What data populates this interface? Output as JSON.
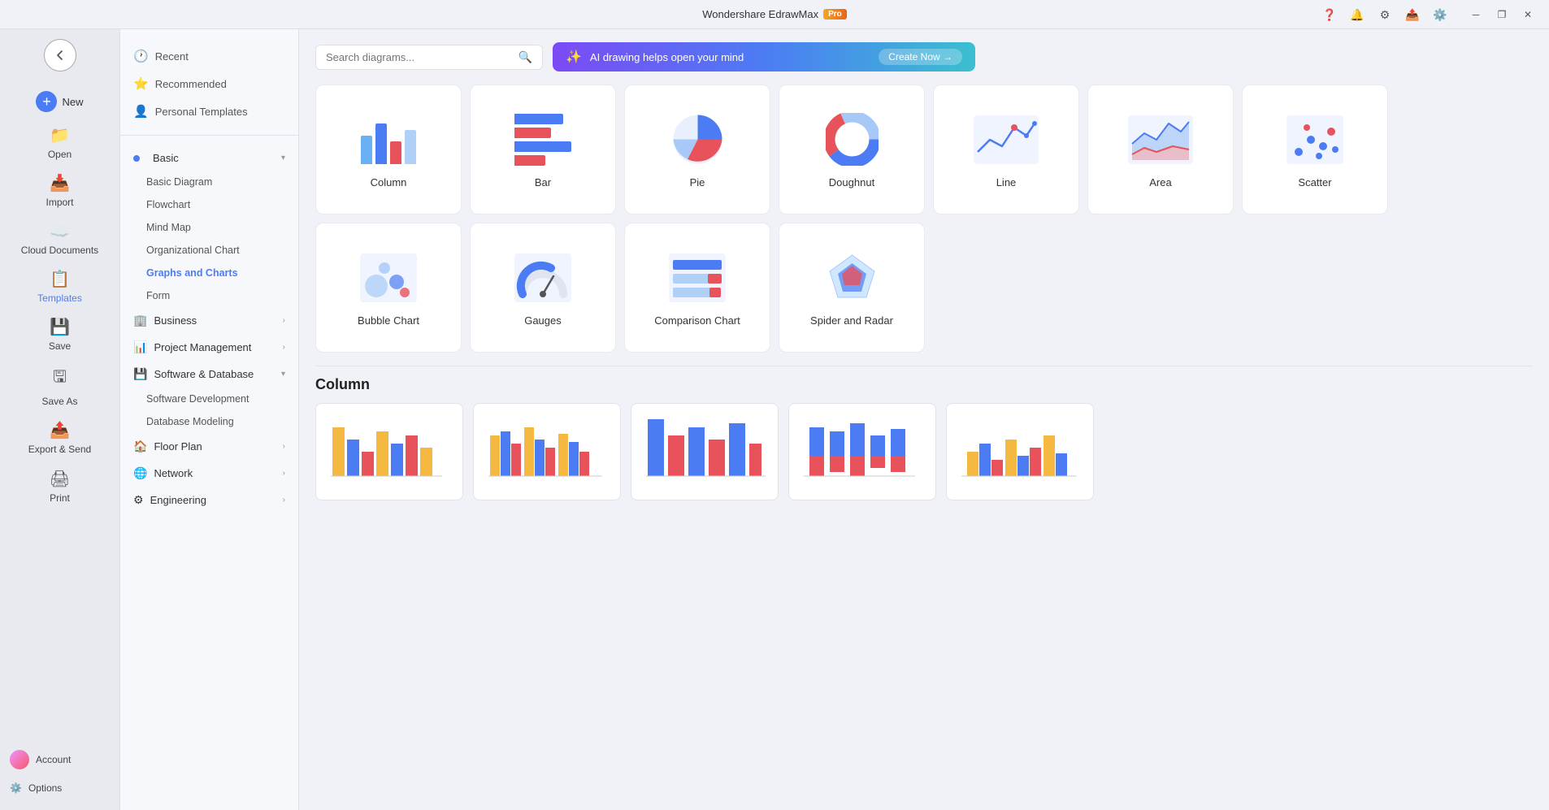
{
  "app": {
    "title": "Wondershare EdrawMax",
    "pro_badge": "Pro"
  },
  "sidebar_left": {
    "new_label": "New",
    "open_label": "Open",
    "import_label": "Import",
    "cloud_label": "Cloud Documents",
    "templates_label": "Templates",
    "save_label": "Save",
    "save_as_label": "Save As",
    "export_label": "Export & Send",
    "print_label": "Print",
    "account_label": "Account",
    "options_label": "Options"
  },
  "sidebar_mid": {
    "recent_label": "Recent",
    "recommended_label": "Recommended",
    "personal_label": "Personal Templates",
    "basic_label": "Basic",
    "basic_items": [
      {
        "label": "Basic Diagram"
      },
      {
        "label": "Flowchart"
      },
      {
        "label": "Mind Map"
      },
      {
        "label": "Organizational Chart"
      },
      {
        "label": "Graphs and Charts",
        "active": true
      },
      {
        "label": "Form"
      }
    ],
    "business_label": "Business",
    "project_label": "Project Management",
    "software_label": "Software & Database",
    "software_items": [
      {
        "label": "Software Development"
      },
      {
        "label": "Database Modeling"
      }
    ],
    "floorplan_label": "Floor Plan",
    "network_label": "Network",
    "engineering_label": "Engineering"
  },
  "search": {
    "placeholder": "Search diagrams..."
  },
  "ai_banner": {
    "text": "AI drawing helps open your mind",
    "cta": "Create Now →"
  },
  "chart_types": [
    {
      "id": "column",
      "label": "Column"
    },
    {
      "id": "bar",
      "label": "Bar"
    },
    {
      "id": "pie",
      "label": "Pie"
    },
    {
      "id": "doughnut",
      "label": "Doughnut"
    },
    {
      "id": "line",
      "label": "Line"
    },
    {
      "id": "area",
      "label": "Area"
    },
    {
      "id": "scatter",
      "label": "Scatter"
    },
    {
      "id": "bubble",
      "label": "Bubble Chart"
    },
    {
      "id": "gauges",
      "label": "Gauges"
    },
    {
      "id": "comparison",
      "label": "Comparison Chart"
    },
    {
      "id": "spider",
      "label": "Spider and Radar"
    }
  ],
  "column_section": {
    "title": "Column",
    "templates_count": 5
  }
}
